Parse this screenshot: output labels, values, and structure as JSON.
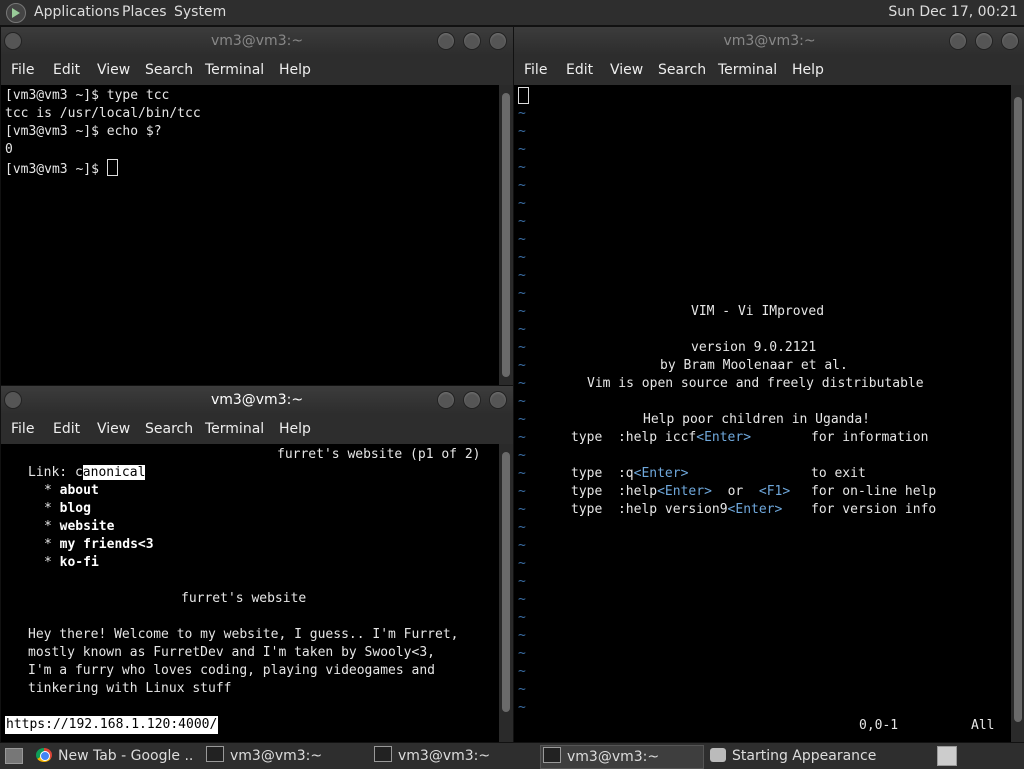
{
  "top_panel": {
    "menus": [
      "Applications",
      "Places",
      "System"
    ],
    "clock": "Sun Dec 17, 00:21"
  },
  "menubar_items": [
    "File",
    "Edit",
    "View",
    "Search",
    "Terminal",
    "Help"
  ],
  "windows": {
    "top_left": {
      "title": "vm3@vm3:~",
      "lines": [
        "[vm3@vm3 ~]$ type tcc",
        "tcc is /usr/local/bin/tcc",
        "[vm3@vm3 ~]$ echo $?",
        "0"
      ],
      "prompt": "[vm3@vm3 ~]$ "
    },
    "bottom_left": {
      "title": "vm3@vm3:~",
      "page_header": "furret's website (p1 of 2)",
      "link_label": "Link: ",
      "link_char": "c",
      "link_selected": "anonical",
      "nav": [
        "about",
        "blog",
        "website",
        "my friends<3",
        "ko-fi"
      ],
      "bullet": "*",
      "heading": "furret's website",
      "paragraph": [
        "Hey there! Welcome to my website, I guess.. I'm Furret,",
        "mostly known as FurretDev and I'm taken by Swooly<3,",
        "I'm a furry who loves coding, playing videogames and",
        "tinkering with Linux stuff"
      ],
      "status_url": "https://192.168.1.120:4000/"
    },
    "right": {
      "title": "vm3@vm3:~",
      "tilde": "~",
      "splash": {
        "title": "VIM - Vi IMproved",
        "version": "version 9.0.2121",
        "author": "by Bram Moolenaar et al.",
        "license": "Vim is open source and freely distributable",
        "charity": "Help poor children in Uganda!",
        "rows": [
          {
            "type": "type",
            "cmd": ":help iccf",
            "key": "<Enter>",
            "or": "",
            "key2": "",
            "desc": "for information"
          },
          {
            "type": "type",
            "cmd": ":q",
            "key": "<Enter>",
            "or": "",
            "key2": "",
            "desc": "to exit"
          },
          {
            "type": "type",
            "cmd": ":help",
            "key": "<Enter>",
            "or": "or",
            "key2": "<F1>",
            "desc": "for on-line help"
          },
          {
            "type": "type",
            "cmd": ":help version9",
            "key": "<Enter>",
            "or": "",
            "key2": "",
            "desc": "for version info"
          }
        ]
      },
      "position": "0,0-1",
      "scroll": "All"
    }
  },
  "taskbar": {
    "tasks": [
      "New Tab - Google ...",
      "vm3@vm3:~",
      "vm3@vm3:~",
      "vm3@vm3:~",
      "Starting Appearance"
    ]
  }
}
